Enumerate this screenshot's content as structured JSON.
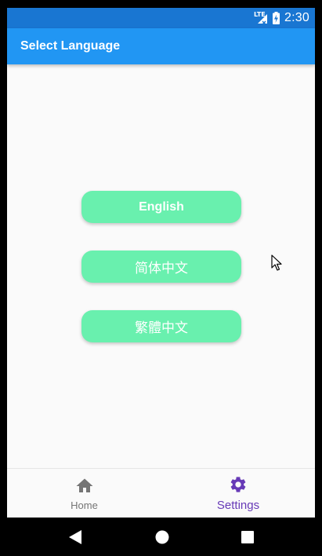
{
  "status_bar": {
    "time": "2:30",
    "network_label": "LTE",
    "icons": [
      "lte-signal-icon",
      "battery-charging-icon"
    ]
  },
  "app_bar": {
    "title": "Select Language"
  },
  "languages": [
    {
      "label": "English"
    },
    {
      "label": "简体中文"
    },
    {
      "label": "繁體中文"
    }
  ],
  "bottom_nav": {
    "items": [
      {
        "label": "Home",
        "icon": "home-icon",
        "selected": false
      },
      {
        "label": "Settings",
        "icon": "gear-icon",
        "selected": true
      }
    ]
  },
  "system_nav": {
    "icons": [
      "back-icon",
      "home-circle-icon",
      "recents-icon"
    ]
  },
  "colors": {
    "status_bar": "#1976d2",
    "app_bar": "#2196f3",
    "button": "#69f0ae",
    "nav_selected": "#673ab7",
    "nav_unselected": "#757575",
    "background": "#fafafa"
  }
}
